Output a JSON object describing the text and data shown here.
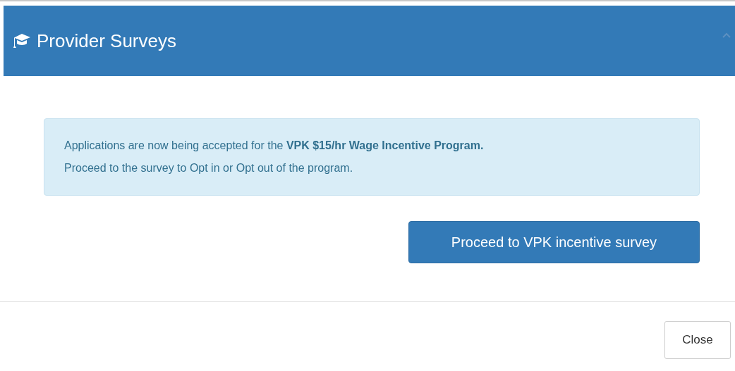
{
  "header": {
    "title": "Provider Surveys"
  },
  "alert": {
    "lines": [
      "Applications are now being accepted for the **VPK $15/hr Wage Incentive Program.**",
      "Proceed to the survey to Opt in or Opt out of the program."
    ]
  },
  "primary_button": {
    "label": "Proceed to VPK incentive survey"
  },
  "footer": {
    "buttons": [
      "Close"
    ]
  }
}
